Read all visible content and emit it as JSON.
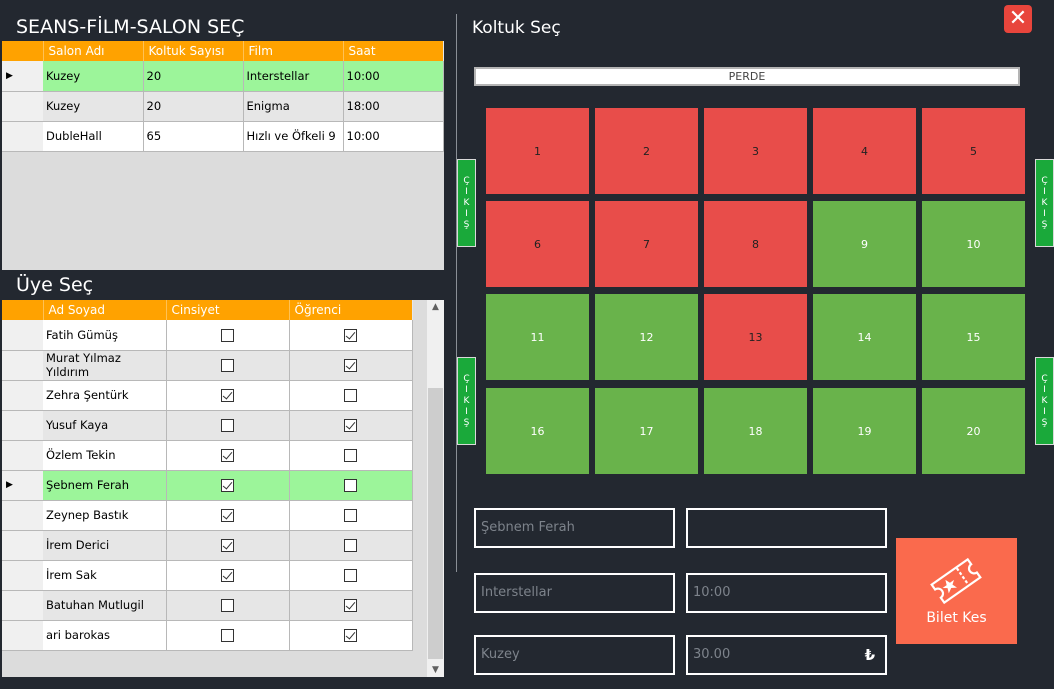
{
  "close_icon": "✕",
  "seans": {
    "title": "SEANS-FİLM-SALON SEÇ",
    "columns": [
      "Salon Adı",
      "Koltuk Sayısı",
      "Film",
      "Saat"
    ],
    "rows": [
      {
        "salon": "Kuzey",
        "koltuk": "20",
        "film": "Interstellar",
        "saat": "10:00"
      },
      {
        "salon": "Kuzey",
        "koltuk": "20",
        "film": "Enigma",
        "saat": "18:00"
      },
      {
        "salon": "DubleHall",
        "koltuk": "65",
        "film": "Hızlı ve Öfkeli 9",
        "saat": "10:00"
      }
    ],
    "selected_row": 0
  },
  "uye": {
    "title": "Üye Seç",
    "columns": [
      "Ad Soyad",
      "Cinsiyet",
      "Öğrenci"
    ],
    "rows": [
      {
        "name": "Fatih Gümüş",
        "cinsiyet": false,
        "ogrenci": true
      },
      {
        "name": "Murat Yılmaz Yıldırım",
        "cinsiyet": false,
        "ogrenci": true
      },
      {
        "name": "Zehra Şentürk",
        "cinsiyet": true,
        "ogrenci": false
      },
      {
        "name": "Yusuf Kaya",
        "cinsiyet": false,
        "ogrenci": true
      },
      {
        "name": "Özlem Tekin",
        "cinsiyet": true,
        "ogrenci": false
      },
      {
        "name": "Şebnem Ferah",
        "cinsiyet": true,
        "ogrenci": false
      },
      {
        "name": "Zeynep Bastık",
        "cinsiyet": true,
        "ogrenci": false
      },
      {
        "name": "İrem Derici",
        "cinsiyet": true,
        "ogrenci": false
      },
      {
        "name": "İrem Sak",
        "cinsiyet": true,
        "ogrenci": false
      },
      {
        "name": "Batuhan Mutlugil",
        "cinsiyet": false,
        "ogrenci": true
      },
      {
        "name": "ari barokas",
        "cinsiyet": false,
        "ogrenci": true
      }
    ],
    "selected_row": 5
  },
  "koltuk": {
    "title": "Koltuk Seç",
    "perde": "PERDE",
    "exit_label": "ÇIKIŞ",
    "seats": [
      {
        "no": "1",
        "status": "taken"
      },
      {
        "no": "2",
        "status": "taken"
      },
      {
        "no": "3",
        "status": "taken"
      },
      {
        "no": "4",
        "status": "taken"
      },
      {
        "no": "5",
        "status": "taken"
      },
      {
        "no": "6",
        "status": "taken"
      },
      {
        "no": "7",
        "status": "taken"
      },
      {
        "no": "8",
        "status": "taken"
      },
      {
        "no": "9",
        "status": "free"
      },
      {
        "no": "10",
        "status": "free"
      },
      {
        "no": "11",
        "status": "free"
      },
      {
        "no": "12",
        "status": "free"
      },
      {
        "no": "13",
        "status": "taken"
      },
      {
        "no": "14",
        "status": "free"
      },
      {
        "no": "15",
        "status": "free"
      },
      {
        "no": "16",
        "status": "free"
      },
      {
        "no": "17",
        "status": "free"
      },
      {
        "no": "18",
        "status": "free"
      },
      {
        "no": "19",
        "status": "free"
      },
      {
        "no": "20",
        "status": "free"
      }
    ],
    "colors": {
      "taken": "#e84d4a",
      "free": "#69b34b"
    }
  },
  "form": {
    "uye": "Şebnem Ferah",
    "koltuk": "",
    "film": "Interstellar",
    "saat": "10:00",
    "salon": "Kuzey",
    "ucret": "30.00",
    "currency": "₺",
    "bilet_button": "Bilet Kes"
  }
}
